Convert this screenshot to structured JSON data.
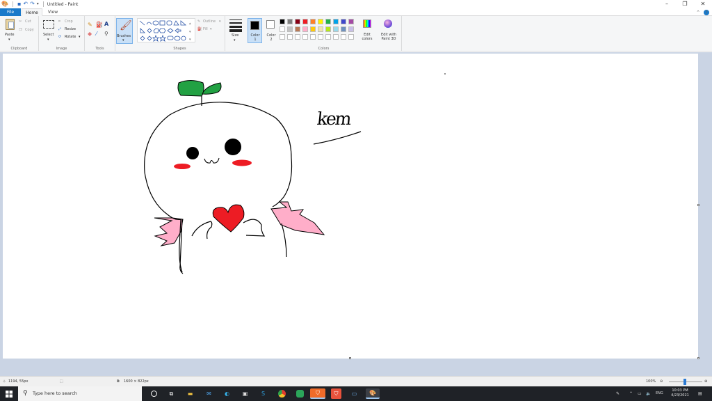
{
  "window": {
    "title": "Untitled - Paint",
    "controls": {
      "minimize": "–",
      "maximize": "❐",
      "close": "✕"
    }
  },
  "menu": {
    "tabs": [
      "File",
      "Home",
      "View"
    ],
    "active": "Home"
  },
  "ribbon": {
    "clipboard": {
      "label": "Clipboard",
      "paste": "Paste",
      "cut": "Cut",
      "copy": "Copy"
    },
    "image": {
      "label": "Image",
      "select": "Select",
      "crop": "Crop",
      "resize": "Resize",
      "rotate": "Rotate"
    },
    "tools": {
      "label": "Tools"
    },
    "brushes": {
      "label": "Brushes"
    },
    "shapes": {
      "label": "Shapes",
      "outline": "Outline",
      "fill": "Fill"
    },
    "size": {
      "label": "Size"
    },
    "colors": {
      "label": "Colors",
      "color1": "Color 1",
      "color2": "Color 2",
      "edit_colors": "Edit colors",
      "edit_paint3d": "Edit with Paint 3D",
      "color1_value": "#000000",
      "color2_value": "#ffffff",
      "palette_row1": [
        "#000000",
        "#7f7f7f",
        "#880015",
        "#ed1c24",
        "#ff7f27",
        "#fff200",
        "#22b14c",
        "#00a2e8",
        "#3f48cc",
        "#a349a4"
      ],
      "palette_row2": [
        "#ffffff",
        "#c3c3c3",
        "#b97a57",
        "#ffaec9",
        "#ffc90e",
        "#efe4b0",
        "#b5e61d",
        "#99d9ea",
        "#7092be",
        "#c8bfe7"
      ]
    }
  },
  "canvas": {
    "handwriting": "kem"
  },
  "status": {
    "cursor_position": "1194, 55px",
    "canvas_size": "1600 × 822px",
    "zoom": "100%"
  },
  "taskbar": {
    "search_placeholder": "Type here to search",
    "language": "ENG",
    "time": "10:03 PM",
    "date": "4/23/2021"
  }
}
